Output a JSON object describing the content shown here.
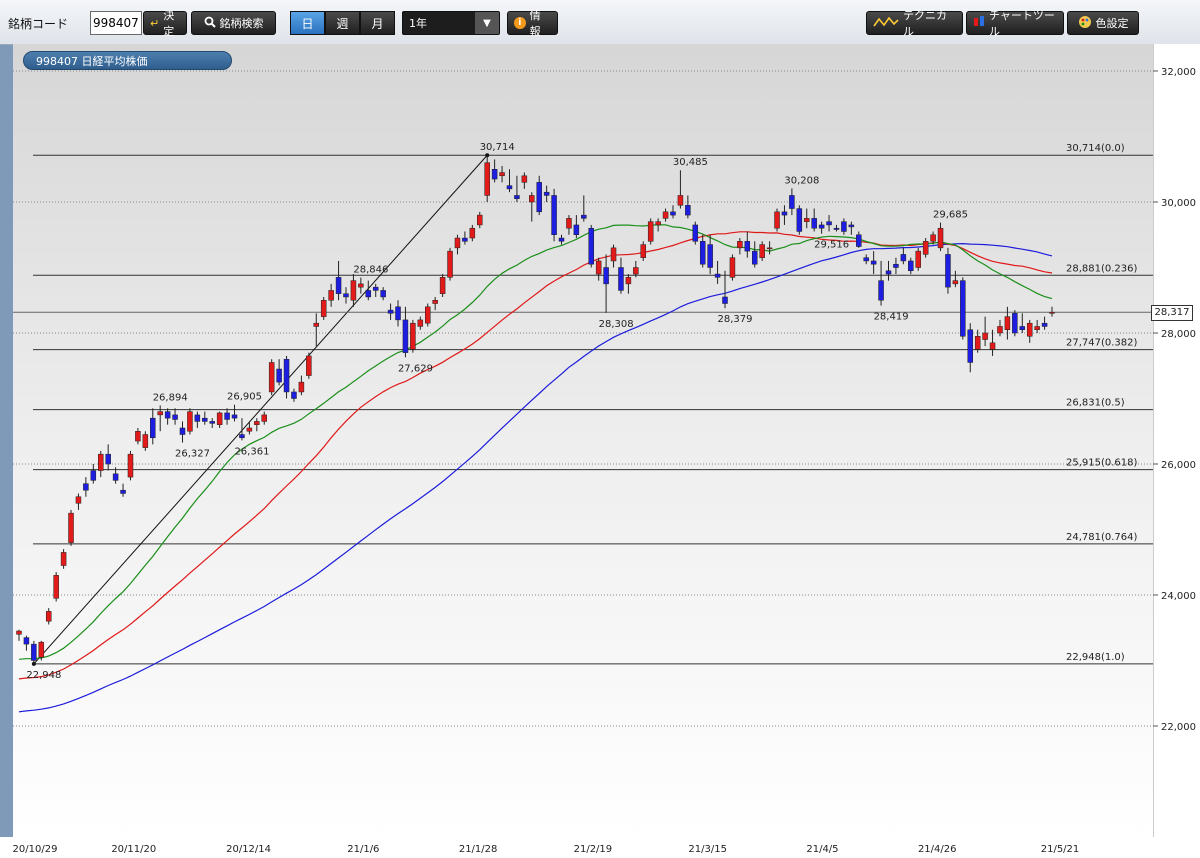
{
  "toolbar": {
    "code_label": "銘柄コード",
    "code_value": "998407",
    "decide_label": "決定",
    "search_label": "銘柄検索",
    "period_buttons": [
      "日",
      "週",
      "月"
    ],
    "period_active": "日",
    "range_select": "1年",
    "info_label": "情報",
    "technical_label": "テクニカル",
    "chart_tool_label": "チャートツール",
    "color_setting_label": "色設定"
  },
  "symbol_badge": "998407 日経平均株価",
  "current_price_tag": "28,317",
  "colors": {
    "up": "#e21a1a",
    "down": "#1e1ee0",
    "ma_short": "#1a8f1a",
    "ma_mid": "#e01818",
    "ma_long": "#1c1cdc"
  },
  "chart_data": {
    "type": "candlestick",
    "y_axis": {
      "ticks": [
        22000,
        24000,
        26000,
        28000,
        30000,
        32000
      ],
      "tick_labels": [
        "22,000",
        "24,000",
        "26,000",
        "28,000",
        "30,000",
        "32,000"
      ]
    },
    "x_axis": {
      "tick_labels": [
        "20/10/29",
        "20/11/20",
        "20/12/14",
        "21/1/6",
        "21/1/28",
        "21/2/19",
        "21/3/15",
        "21/4/5",
        "21/4/26",
        "21/5/21"
      ]
    },
    "annotations": [
      {
        "label": "22,948",
        "value": 22948
      },
      {
        "label": "26,894",
        "value": 26894
      },
      {
        "label": "26,327",
        "value": 26327
      },
      {
        "label": "26,905",
        "value": 26905
      },
      {
        "label": "26,361",
        "value": 26361
      },
      {
        "label": "28,846",
        "value": 28846
      },
      {
        "label": "27,629",
        "value": 27629
      },
      {
        "label": "30,714",
        "value": 30714
      },
      {
        "label": "28,308",
        "value": 28308
      },
      {
        "label": "30,485",
        "value": 30485
      },
      {
        "label": "28,379",
        "value": 28379
      },
      {
        "label": "30,208",
        "value": 30208
      },
      {
        "label": "29,516",
        "value": 29516
      },
      {
        "label": "28,419",
        "value": 28419
      },
      {
        "label": "29,685",
        "value": 29685
      }
    ],
    "fibonacci": {
      "high": 30714,
      "low": 22948,
      "levels": [
        {
          "label": "30,714(0.0)",
          "value": 30714
        },
        {
          "label": "28,881(0.236)",
          "value": 28881
        },
        {
          "label": "27,747(0.382)",
          "value": 27747
        },
        {
          "label": "26,831(0.5)",
          "value": 26831
        },
        {
          "label": "25,915(0.618)",
          "value": 25915
        },
        {
          "label": "24,781(0.764)",
          "value": 24781
        },
        {
          "label": "22,948(1.0)",
          "value": 22948
        }
      ]
    },
    "trendline": {
      "from_value": 22948,
      "to_value": 30714
    },
    "last_price": 28317,
    "ohlc": [
      [
        23400,
        23470,
        23300,
        23450
      ],
      [
        23350,
        23380,
        23150,
        23250
      ],
      [
        23250,
        23300,
        22948,
        23000
      ],
      [
        23050,
        23300,
        23000,
        23280
      ],
      [
        23600,
        23800,
        23550,
        23750
      ],
      [
        23950,
        24350,
        23900,
        24300
      ],
      [
        24450,
        24700,
        24400,
        24650
      ],
      [
        24800,
        25300,
        24750,
        25250
      ],
      [
        25400,
        25550,
        25300,
        25500
      ],
      [
        25700,
        25800,
        25500,
        25600
      ],
      [
        25900,
        26000,
        25700,
        25750
      ],
      [
        25900,
        26200,
        25800,
        26150
      ],
      [
        26150,
        26300,
        25900,
        26000
      ],
      [
        25850,
        25950,
        25700,
        25750
      ],
      [
        25600,
        25700,
        25500,
        25550
      ],
      [
        25800,
        26200,
        25750,
        26150
      ],
      [
        26350,
        26550,
        26300,
        26500
      ],
      [
        26250,
        26500,
        26200,
        26450
      ],
      [
        26700,
        26850,
        26300,
        26400
      ],
      [
        26750,
        26894,
        26500,
        26800
      ],
      [
        26800,
        26850,
        26600,
        26700
      ],
      [
        26750,
        26850,
        26600,
        26680
      ],
      [
        26550,
        26650,
        26327,
        26450
      ],
      [
        26500,
        26850,
        26450,
        26800
      ],
      [
        26750,
        26800,
        26550,
        26650
      ],
      [
        26700,
        26800,
        26600,
        26650
      ],
      [
        26650,
        26700,
        26550,
        26620
      ],
      [
        26600,
        26800,
        26550,
        26780
      ],
      [
        26780,
        26850,
        26600,
        26680
      ],
      [
        26750,
        26905,
        26650,
        26700
      ],
      [
        26450,
        26700,
        26361,
        26400
      ],
      [
        26500,
        26650,
        26450,
        26550
      ],
      [
        26600,
        26700,
        26500,
        26650
      ],
      [
        26650,
        26800,
        26600,
        26750
      ],
      [
        27100,
        27600,
        27050,
        27550
      ],
      [
        27450,
        27600,
        27200,
        27250
      ],
      [
        27600,
        27650,
        27000,
        27100
      ],
      [
        27100,
        27150,
        26950,
        27000
      ],
      [
        27100,
        27350,
        27050,
        27250
      ],
      [
        27350,
        27700,
        27300,
        27650
      ],
      [
        28100,
        28300,
        27800,
        28150
      ],
      [
        28250,
        28550,
        28200,
        28500
      ],
      [
        28500,
        28750,
        28400,
        28650
      ],
      [
        28850,
        29100,
        28500,
        28600
      ],
      [
        28600,
        28700,
        28450,
        28550
      ],
      [
        28500,
        28900,
        28400,
        28800
      ],
      [
        28700,
        28846,
        28600,
        28750
      ],
      [
        28650,
        28800,
        28500,
        28550
      ],
      [
        28700,
        28750,
        28550,
        28650
      ],
      [
        28650,
        28700,
        28500,
        28550
      ],
      [
        28350,
        28450,
        28200,
        28300
      ],
      [
        28400,
        28500,
        28100,
        28200
      ],
      [
        28200,
        28400,
        27629,
        27700
      ],
      [
        27750,
        28200,
        27700,
        28150
      ],
      [
        28100,
        28250,
        28050,
        28200
      ],
      [
        28150,
        28450,
        28100,
        28400
      ],
      [
        28450,
        28550,
        28350,
        28500
      ],
      [
        28600,
        28900,
        28550,
        28850
      ],
      [
        28850,
        29300,
        28800,
        29250
      ],
      [
        29300,
        29500,
        29200,
        29450
      ],
      [
        29450,
        29550,
        29350,
        29400
      ],
      [
        29450,
        29650,
        29400,
        29600
      ],
      [
        29650,
        29850,
        29600,
        29800
      ],
      [
        30100,
        30714,
        30000,
        30600
      ],
      [
        30500,
        30650,
        30300,
        30350
      ],
      [
        30400,
        30550,
        30300,
        30450
      ],
      [
        30250,
        30500,
        30150,
        30200
      ],
      [
        30100,
        30400,
        30000,
        30050
      ],
      [
        30300,
        30450,
        30200,
        30400
      ],
      [
        30000,
        30150,
        29700,
        30100
      ],
      [
        30300,
        30400,
        29800,
        29850
      ],
      [
        30150,
        30250,
        30000,
        30100
      ],
      [
        30100,
        30200,
        29400,
        29500
      ],
      [
        29450,
        29500,
        29350,
        29400
      ],
      [
        29600,
        29800,
        29500,
        29750
      ],
      [
        29650,
        29800,
        29450,
        29500
      ],
      [
        29800,
        30100,
        29700,
        29750
      ],
      [
        29600,
        29650,
        29000,
        29050
      ],
      [
        28900,
        29150,
        28800,
        29100
      ],
      [
        29000,
        29200,
        28308,
        28750
      ],
      [
        29100,
        29350,
        29000,
        29300
      ],
      [
        29000,
        29150,
        28600,
        28650
      ],
      [
        28750,
        28900,
        28600,
        28850
      ],
      [
        28900,
        29100,
        28850,
        29000
      ],
      [
        29150,
        29400,
        29100,
        29350
      ],
      [
        29400,
        29750,
        29350,
        29700
      ],
      [
        29650,
        29750,
        29550,
        29700
      ],
      [
        29750,
        29900,
        29700,
        29850
      ],
      [
        29850,
        29950,
        29750,
        29800
      ],
      [
        29950,
        30485,
        29900,
        30100
      ],
      [
        29950,
        30100,
        29750,
        29800
      ],
      [
        29650,
        29700,
        29350,
        29400
      ],
      [
        29400,
        29500,
        29000,
        29050
      ],
      [
        29350,
        29500,
        28900,
        29000
      ],
      [
        28900,
        29100,
        28750,
        28850
      ],
      [
        28550,
        28950,
        28379,
        28450
      ],
      [
        28850,
        29200,
        28800,
        29150
      ],
      [
        29300,
        29450,
        29200,
        29400
      ],
      [
        29400,
        29550,
        29150,
        29250
      ],
      [
        29250,
        29400,
        29000,
        29050
      ],
      [
        29150,
        29400,
        29100,
        29350
      ],
      [
        29300,
        29400,
        29200,
        29300
      ],
      [
        29600,
        29900,
        29550,
        29850
      ],
      [
        29850,
        29950,
        29650,
        29800
      ],
      [
        30100,
        30208,
        29800,
        29900
      ],
      [
        29900,
        29950,
        29500,
        29550
      ],
      [
        29700,
        29900,
        29600,
        29750
      ],
      [
        29750,
        29900,
        29550,
        29600
      ],
      [
        29650,
        29700,
        29516,
        29600
      ],
      [
        29700,
        29800,
        29550,
        29650
      ],
      [
        29600,
        29650,
        29550,
        29580
      ],
      [
        29700,
        29750,
        29500,
        29550
      ],
      [
        29650,
        29700,
        29500,
        29620
      ],
      [
        29500,
        29550,
        29300,
        29320
      ],
      [
        29150,
        29200,
        29050,
        29100
      ],
      [
        29100,
        29250,
        28900,
        29050
      ],
      [
        28800,
        29100,
        28419,
        28500
      ],
      [
        28950,
        29100,
        28800,
        28900
      ],
      [
        29050,
        29150,
        28900,
        29000
      ],
      [
        29200,
        29300,
        29050,
        29100
      ],
      [
        29100,
        29150,
        28900,
        28950
      ],
      [
        29000,
        29300,
        28950,
        29250
      ],
      [
        29200,
        29450,
        29150,
        29400
      ],
      [
        29400,
        29550,
        29350,
        29500
      ],
      [
        29300,
        29685,
        29250,
        29600
      ],
      [
        29200,
        29300,
        28600,
        28700
      ],
      [
        28750,
        28950,
        28700,
        28800
      ],
      [
        28800,
        28850,
        27900,
        27950
      ],
      [
        28050,
        28150,
        27400,
        27550
      ],
      [
        27750,
        28050,
        27700,
        27950
      ],
      [
        27900,
        28250,
        27800,
        28000
      ],
      [
        27750,
        28050,
        27650,
        27850
      ],
      [
        28000,
        28200,
        27950,
        28100
      ],
      [
        28050,
        28400,
        27900,
        28250
      ],
      [
        28300,
        28350,
        27950,
        28000
      ],
      [
        28100,
        28300,
        28000,
        28050
      ],
      [
        27950,
        28200,
        27850,
        28150
      ],
      [
        28050,
        28200,
        28000,
        28100
      ],
      [
        28150,
        28250,
        28050,
        28100
      ],
      [
        28300,
        28400,
        28250,
        28317
      ]
    ]
  }
}
